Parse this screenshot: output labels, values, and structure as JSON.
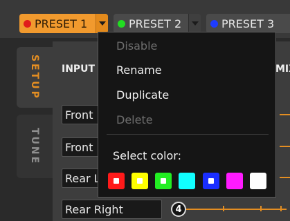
{
  "presets": [
    {
      "label": "PRESET 1",
      "dot_color": "#e01b1b",
      "active": true
    },
    {
      "label": "PRESET 2",
      "dot_color": "#22dd22",
      "active": false
    },
    {
      "label": "PRESET 3",
      "dot_color": "#1e3cff",
      "active": false
    }
  ],
  "side_tabs": {
    "setup": "SETUP",
    "tune": "TUNE"
  },
  "panel": {
    "input_header": "INPUT",
    "mix_header": "MIX"
  },
  "channels": [
    "Front Left",
    "Front Right",
    "Rear Left",
    "Rear Right"
  ],
  "channel_badge": "4",
  "context_menu": {
    "items": [
      {
        "label": "Disable",
        "enabled": false
      },
      {
        "label": "Rename",
        "enabled": true
      },
      {
        "label": "Duplicate",
        "enabled": true
      },
      {
        "label": "Delete",
        "enabled": false
      }
    ],
    "select_color_label": "Select color:",
    "swatches": [
      {
        "name": "red",
        "color": "#ff1a1a",
        "selected": true
      },
      {
        "name": "yellow",
        "color": "#ffff00",
        "selected": true
      },
      {
        "name": "green",
        "color": "#22ee22",
        "selected": true
      },
      {
        "name": "cyan",
        "color": "#11ffff",
        "selected": false
      },
      {
        "name": "blue",
        "color": "#1a2eff",
        "selected": true
      },
      {
        "name": "magenta",
        "color": "#ff1aff",
        "selected": false
      },
      {
        "name": "white",
        "color": "#ffffff",
        "selected": false
      }
    ]
  },
  "colors": {
    "accent": "#f19a2e",
    "slider": "#e48e22"
  }
}
